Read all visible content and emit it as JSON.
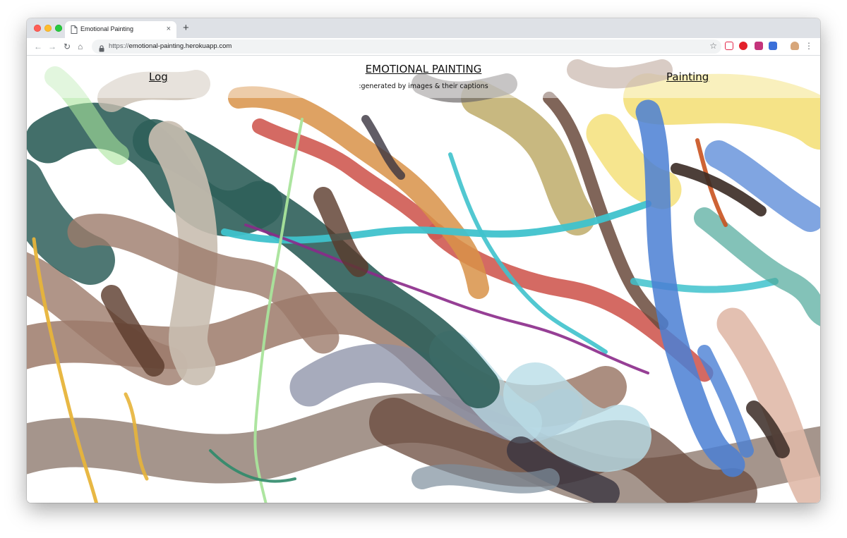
{
  "browser": {
    "tab_title": "Emotional Painting",
    "tab_close": "×",
    "new_tab": "+",
    "url_protocol": "https://",
    "url_host": "emotional-painting.herokuapp.com",
    "nav": {
      "back": "←",
      "forward": "→",
      "reload": "↻",
      "home": "⌂"
    },
    "bookmark_star": "☆",
    "menu": "⋮",
    "extensions": [
      "pocket-icon",
      "opera-icon",
      "extension-icon",
      "people-icon",
      "hand-icon"
    ]
  },
  "page": {
    "nav_left": "Log",
    "title": "EMOTIONAL PAINTING",
    "subtitle": ":generated by images & their captions",
    "nav_right": "Painting"
  },
  "colors": {
    "tabbar_bg": "#dee1e6",
    "stroke_palette": [
      "#2f5f5a",
      "#c9beb0",
      "#9c7a6a",
      "#cf5a52",
      "#d89248",
      "#3fc2cc",
      "#4a7fd4",
      "#f4e07a",
      "#6a4a3c",
      "#8b2a8a",
      "#a9e49b",
      "#e0b9a8",
      "#b9dde7",
      "#e7b43a"
    ]
  }
}
